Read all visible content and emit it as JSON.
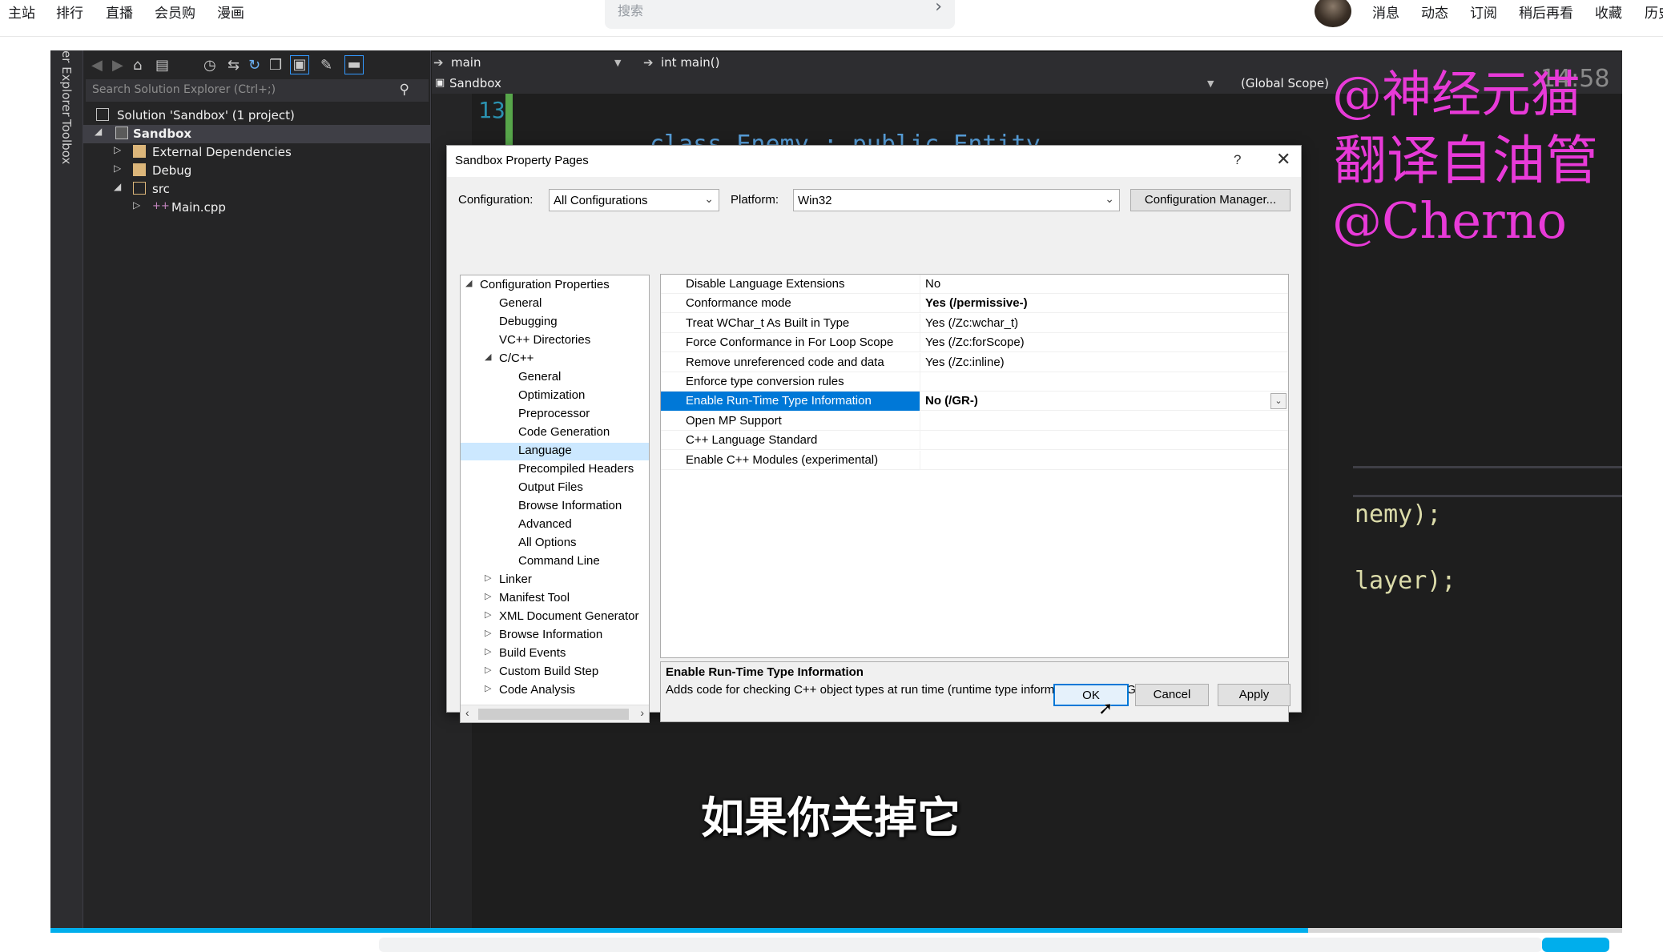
{
  "site": {
    "nav_left": [
      "主站",
      "排行",
      "直播",
      "会员购",
      "漫画"
    ],
    "search_placeholder": "搜索",
    "nav_right": [
      "消息",
      "动态",
      "订阅",
      "稍后再看",
      "收藏",
      "历史"
    ]
  },
  "vs": {
    "side_tabs": [
      "er Explorer",
      "Toolbox"
    ],
    "search_placeholder": "Search Solution Explorer (Ctrl+;)",
    "tree": {
      "solution": "Solution 'Sandbox' (1 project)",
      "project": "Sandbox",
      "external_deps": "External Dependencies",
      "debug": "Debug",
      "src": "src",
      "main_cpp": "Main.cpp"
    },
    "nav": {
      "function_scope": "main",
      "function_sig": "int main()",
      "project": "Sandbox",
      "scope": "(Global Scope)"
    },
    "line_number": "13",
    "code_visible": {
      "line14_fragment": "class Enemy : public Entity",
      "fragment1": "nemy);",
      "fragment2": "layer);"
    }
  },
  "watermark": {
    "line1": "@神经元猫",
    "line2": "翻译自油管",
    "line3": "@Cherno",
    "timecode": "14:58"
  },
  "subtitle": "如果你关掉它",
  "dialog": {
    "title": "Sandbox Property Pages",
    "help": "?",
    "close": "✕",
    "configuration_label": "Configuration:",
    "configuration_value": "All Configurations",
    "platform_label": "Platform:",
    "platform_value": "Win32",
    "config_manager_label": "Configuration Manager...",
    "tree": [
      {
        "label": "Configuration Properties",
        "indent": 0,
        "arrow": "◢"
      },
      {
        "label": "General",
        "indent": 1,
        "arrow": ""
      },
      {
        "label": "Debugging",
        "indent": 1,
        "arrow": ""
      },
      {
        "label": "VC++ Directories",
        "indent": 1,
        "arrow": ""
      },
      {
        "label": "C/C++",
        "indent": 1,
        "arrow": "◢"
      },
      {
        "label": "General",
        "indent": 2,
        "arrow": ""
      },
      {
        "label": "Optimization",
        "indent": 2,
        "arrow": ""
      },
      {
        "label": "Preprocessor",
        "indent": 2,
        "arrow": ""
      },
      {
        "label": "Code Generation",
        "indent": 2,
        "arrow": ""
      },
      {
        "label": "Language",
        "indent": 2,
        "arrow": "",
        "selected": true
      },
      {
        "label": "Precompiled Headers",
        "indent": 2,
        "arrow": ""
      },
      {
        "label": "Output Files",
        "indent": 2,
        "arrow": ""
      },
      {
        "label": "Browse Information",
        "indent": 2,
        "arrow": ""
      },
      {
        "label": "Advanced",
        "indent": 2,
        "arrow": ""
      },
      {
        "label": "All Options",
        "indent": 2,
        "arrow": ""
      },
      {
        "label": "Command Line",
        "indent": 2,
        "arrow": ""
      },
      {
        "label": "Linker",
        "indent": 1,
        "arrow": "▷"
      },
      {
        "label": "Manifest Tool",
        "indent": 1,
        "arrow": "▷"
      },
      {
        "label": "XML Document Generator",
        "indent": 1,
        "arrow": "▷"
      },
      {
        "label": "Browse Information",
        "indent": 1,
        "arrow": "▷"
      },
      {
        "label": "Build Events",
        "indent": 1,
        "arrow": "▷"
      },
      {
        "label": "Custom Build Step",
        "indent": 1,
        "arrow": "▷"
      },
      {
        "label": "Code Analysis",
        "indent": 1,
        "arrow": "▷"
      }
    ],
    "properties": [
      {
        "name": "Disable Language Extensions",
        "value": "No",
        "bold": false
      },
      {
        "name": "Conformance mode",
        "value": "Yes (/permissive-)",
        "bold": true
      },
      {
        "name": "Treat WChar_t As Built in Type",
        "value": "Yes (/Zc:wchar_t)",
        "bold": false
      },
      {
        "name": "Force Conformance in For Loop Scope",
        "value": "Yes (/Zc:forScope)",
        "bold": false
      },
      {
        "name": "Remove unreferenced code and data",
        "value": "Yes (/Zc:inline)",
        "bold": false
      },
      {
        "name": "Enforce type conversion rules",
        "value": "",
        "bold": false
      },
      {
        "name": "Enable Run-Time Type Information",
        "value": "No (/GR-)",
        "bold": true,
        "selected": true
      },
      {
        "name": "Open MP Support",
        "value": "",
        "bold": false
      },
      {
        "name": "C++ Language Standard",
        "value": "",
        "bold": false
      },
      {
        "name": "Enable C++ Modules (experimental)",
        "value": "",
        "bold": false
      }
    ],
    "description_title": "Enable Run-Time Type Information",
    "description_text": "Adds code for checking C++ object types at run time (runtime type information).     (/GR, /GR-)",
    "ok_label": "OK",
    "cancel_label": "Cancel",
    "apply_label": "Apply"
  },
  "colors": {
    "accent": "#0078d7",
    "watermark": "#e83ad8",
    "bilibili_blue": "#00aeec"
  },
  "progress": 0.8
}
